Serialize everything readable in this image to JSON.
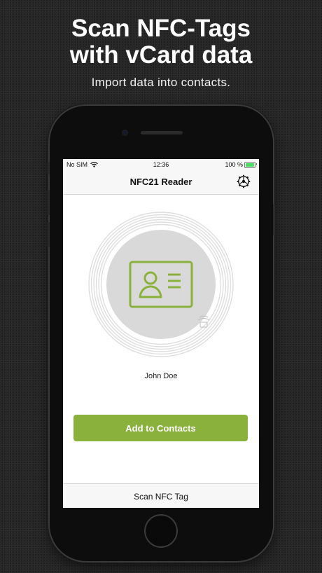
{
  "promo": {
    "headline_line1": "Scan NFC-Tags",
    "headline_line2": "with vCard data",
    "subline": "Import data into contacts."
  },
  "status_bar": {
    "carrier": "No SIM",
    "time": "12:36",
    "battery": "100 %"
  },
  "nav": {
    "title": "NFC21 Reader",
    "settings_icon": "gear-icon"
  },
  "contact": {
    "icon": "contact-card-icon",
    "name": "John Doe"
  },
  "actions": {
    "add_label": "Add to Contacts",
    "scan_label": "Scan NFC Tag"
  },
  "colors": {
    "accent": "#8bb13d",
    "card_bg": "#d8d8d8",
    "background": "#262626"
  }
}
